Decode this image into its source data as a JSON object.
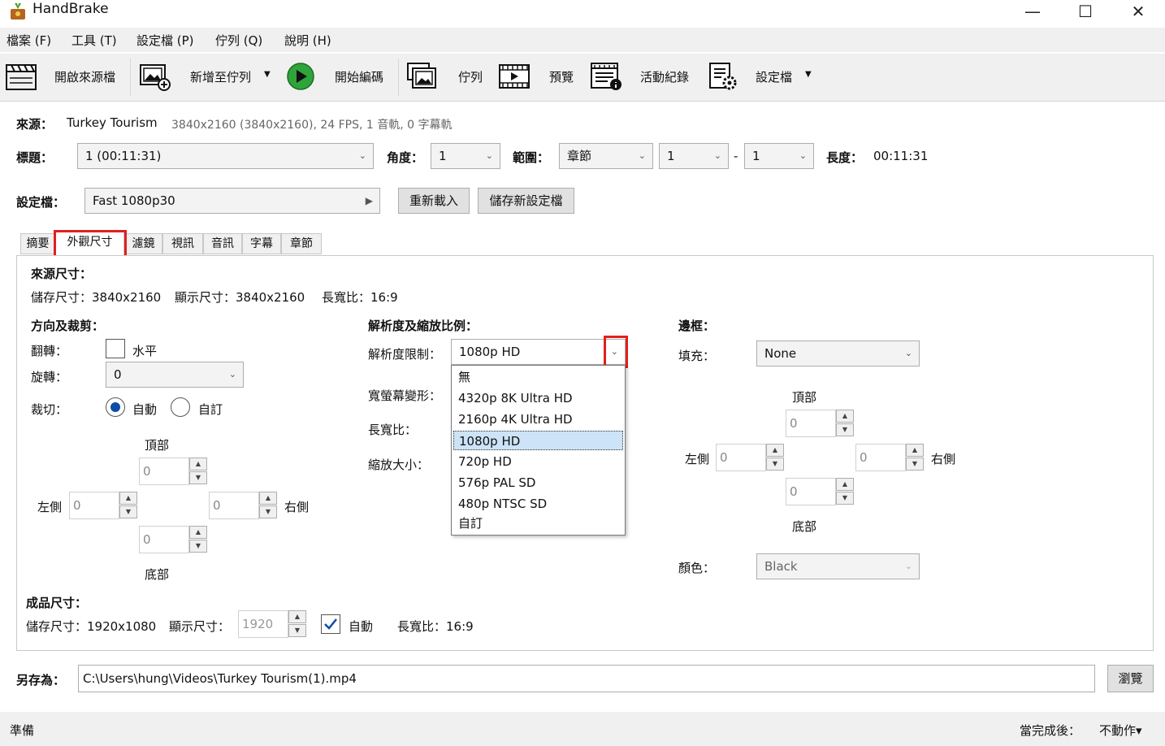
{
  "window": {
    "title": "HandBrake",
    "minimize": "—",
    "maximize": "☐",
    "close": "✕"
  },
  "menu": [
    "檔案 (F)",
    "工具 (T)",
    "設定檔 (P)",
    "佇列 (Q)",
    "說明 (H)"
  ],
  "toolbar": {
    "open_source": "開啟來源檔",
    "add_queue": "新增至佇列",
    "start_encode": "開始編碼",
    "queue": "佇列",
    "preview": "預覽",
    "activity_log": "活動紀錄",
    "presets": "設定檔",
    "arrow": "▼"
  },
  "source": {
    "label": "來源：",
    "name": "Turkey Tourism",
    "info": "3840x2160 (3840x2160), 24 FPS, 1 音軌, 0 字幕軌"
  },
  "title_row": {
    "title_label": "標題：",
    "title_value": "1  (00:11:31)",
    "angle_label": "角度：",
    "angle_value": "1",
    "range_label": "範圍：",
    "range_type": "章節",
    "range_start": "1",
    "range_dash": "-",
    "range_end": "1",
    "duration_label": "長度：",
    "duration_value": "00:11:31"
  },
  "preset_row": {
    "label": "設定檔：",
    "value": "Fast 1080p30",
    "reload": "重新載入",
    "save_new": "儲存新設定檔"
  },
  "tabs": [
    "摘要",
    "外觀尺寸",
    "濾鏡",
    "視訊",
    "音訊",
    "字幕",
    "章節"
  ],
  "dims": {
    "source_title": "來源尺寸：",
    "storage": "儲存尺寸：3840x2160",
    "display": "顯示尺寸：3840x2160",
    "aspect": "長寬比：16:9",
    "orient_title": "方向及裁剪：",
    "flip_label": "翻轉：",
    "flip_horizontal": "水平",
    "rotate_label": "旋轉：",
    "rotate_value": "0",
    "crop_label": "裁切：",
    "crop_auto": "自動",
    "crop_custom": "自訂",
    "top": "頂部",
    "bottom": "底部",
    "left": "左側",
    "right": "右側",
    "zero": "0"
  },
  "resolution": {
    "title": "解析度及縮放比例：",
    "limit_label": "解析度限制：",
    "limit_value": "1080p HD",
    "anamorphic_label": "寬螢幕變形：",
    "aspect_label": "長寬比：",
    "scale_label": "縮放大小：",
    "options": [
      "無",
      "4320p 8K Ultra HD",
      "2160p 4K Ultra HD",
      "1080p HD",
      "720p HD",
      "576p PAL SD",
      "480p NTSC SD",
      "自訂"
    ],
    "selected_index": 3
  },
  "border": {
    "title": "邊框：",
    "fill_label": "填充：",
    "fill_value": "None",
    "color_label": "顏色：",
    "color_value": "Black"
  },
  "output": {
    "title": "成品尺寸：",
    "storage": "儲存尺寸：1920x1080",
    "display_label": "顯示尺寸：",
    "display_value": "1920",
    "auto": "自動",
    "aspect": "長寬比：16:9"
  },
  "save_as": {
    "label": "另存為：",
    "path": "C:\\Users\\hung\\Videos\\Turkey Tourism(1).mp4",
    "browse": "瀏覽"
  },
  "status": {
    "ready": "準備",
    "when_done_label": "當完成後：",
    "when_done_value": "不動作▾"
  },
  "colors": {
    "highlight_red": "#e0201e",
    "play_green": "#2fa43a",
    "radio_blue": "#0a4ea8",
    "selected_bg": "#cde3f7"
  }
}
